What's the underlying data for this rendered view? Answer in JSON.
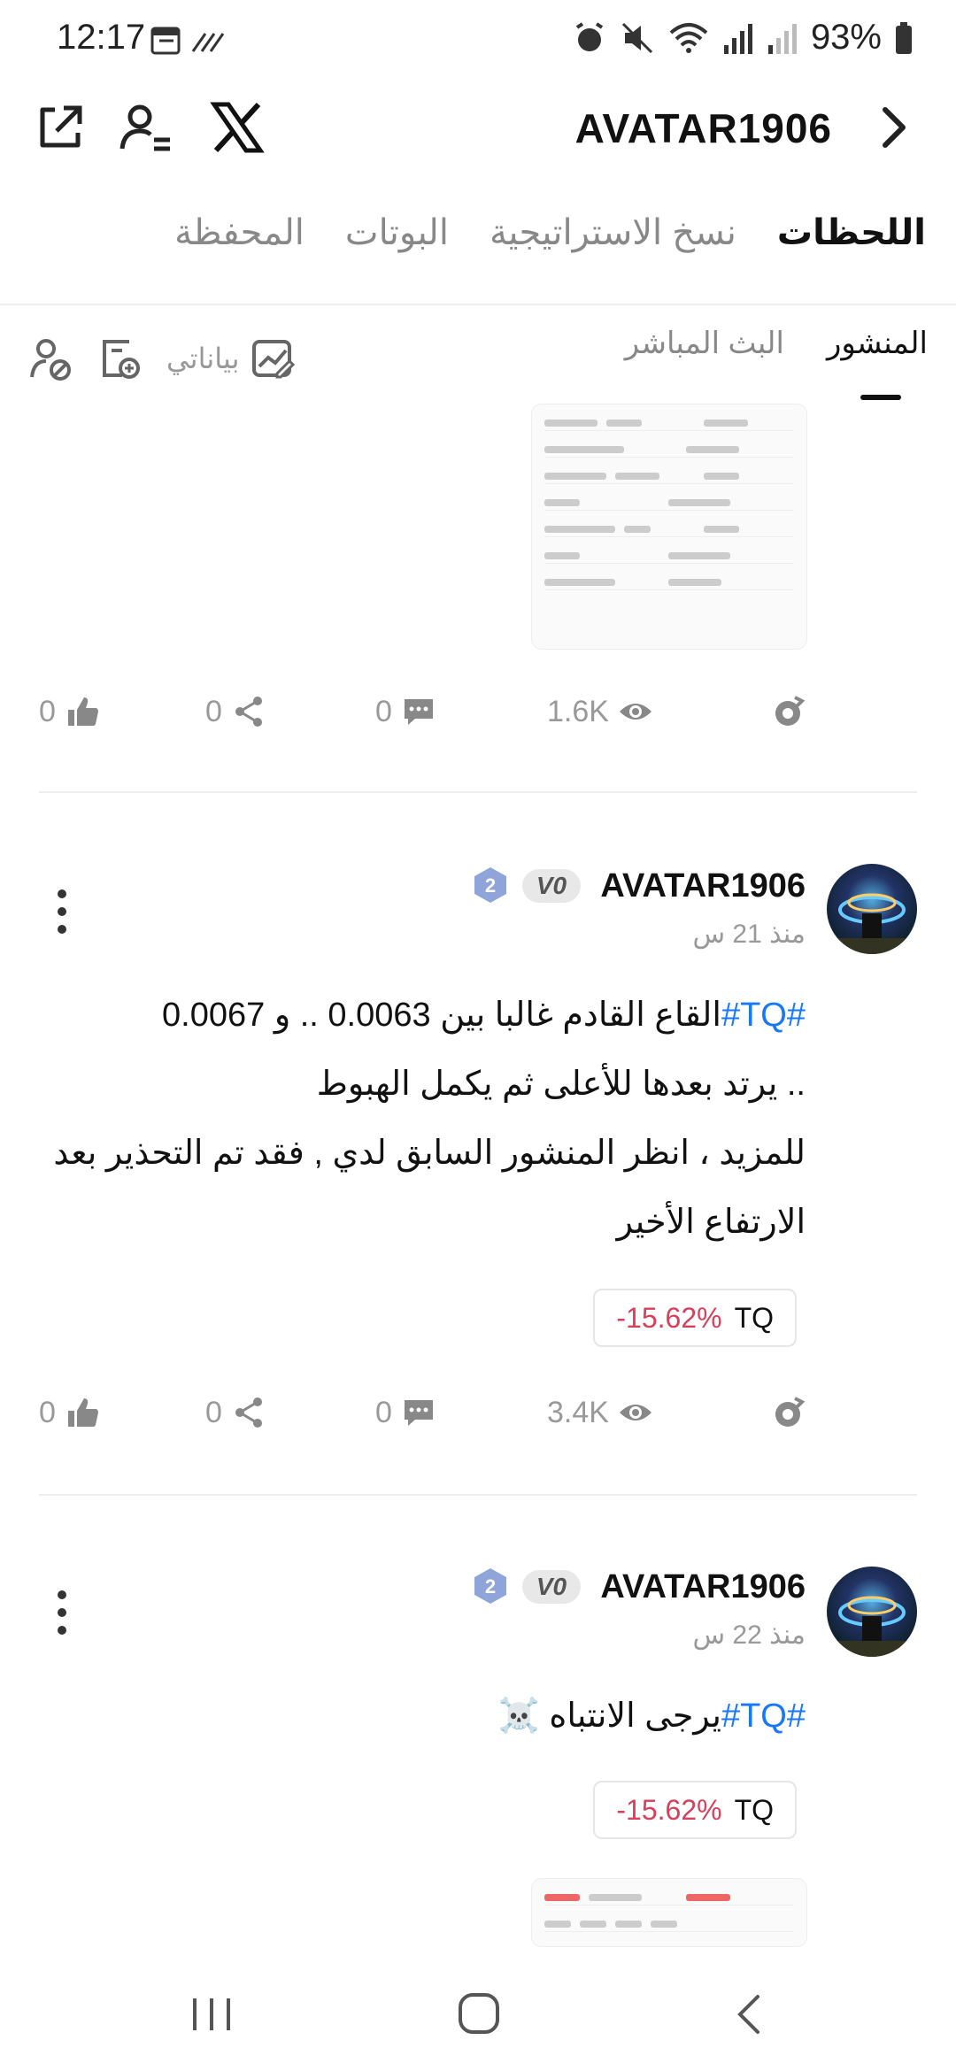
{
  "status_bar": {
    "time": "12:17",
    "battery": "93%"
  },
  "header": {
    "title": "AVATAR1906"
  },
  "main_tabs": [
    "اللحظات",
    "نسخ الاستراتيجية",
    "البوتات",
    "المحفظة"
  ],
  "sub_tabs": [
    "المنشور",
    "البث المباشر"
  ],
  "sub_actions": {
    "my_data": "بياناتي"
  },
  "post0": {
    "stats": {
      "likes": "0",
      "shares": "0",
      "comments": "0",
      "views": "1.6K"
    }
  },
  "post1": {
    "username": "AVATAR1906",
    "level": "2",
    "vip": "V0",
    "time": "منذ 21 س",
    "hashtag": "#TQ#",
    "lines": [
      "القاع القادم غالبا  بين 0.0063 .. و 0.0067",
      ".. يرتد بعدها للأعلى ثم يكمل الهبوط",
      "للمزيد ، انظر المنشور السابق لدي , فقد تم التحذير بعد",
      "الارتفاع الأخير"
    ],
    "coin": "TQ",
    "change": "15.62%-",
    "stats": {
      "likes": "0",
      "shares": "0",
      "comments": "0",
      "views": "3.4K"
    }
  },
  "post2": {
    "username": "AVATAR1906",
    "level": "2",
    "vip": "V0",
    "time": "منذ 22 س",
    "hashtag": "#TQ#",
    "text": "يرجى الانتباه ☠️",
    "coin": "TQ",
    "change": "15.62%-"
  },
  "colors": {
    "accent": "#1677ff",
    "negative": "#d6405a"
  }
}
